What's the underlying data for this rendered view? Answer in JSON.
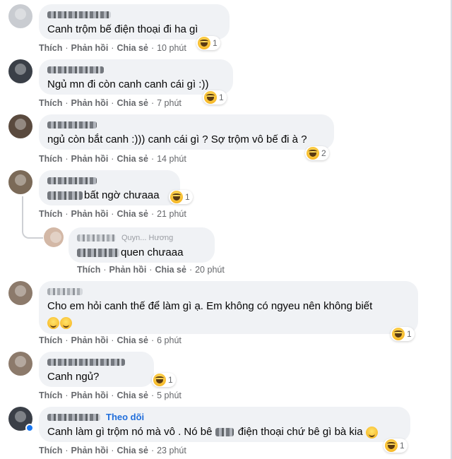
{
  "labels": {
    "like": "Thích",
    "reply": "Phản hồi",
    "share": "Chia sẻ",
    "dot": "·",
    "follow": "Theo dõi"
  },
  "comments": [
    {
      "text": "Canh trộm bế điện thoại đi ha gì",
      "time": "10 phút",
      "reaction_icon": "haha-icon",
      "reaction_count": "1"
    },
    {
      "text": "Ngủ mn đi còn canh canh cái gì :))",
      "time": "7 phút",
      "reaction_icon": "haha-icon",
      "reaction_count": "1"
    },
    {
      "text": "ngủ còn bắt canh :))) canh cái gì ? Sợ trộm vô bế đi à ?",
      "time": "14 phút",
      "reaction_icon": "haha-icon",
      "reaction_count": "2"
    },
    {
      "text": "bất ngờ chưaaa",
      "time": "21 phút",
      "reaction_icon": "haha-icon",
      "reaction_count": "1"
    },
    {
      "author_fragment": "Quyn... Hương",
      "text": "quen chưaaa",
      "time": "20 phút"
    },
    {
      "text": "Cho em hỏi canh thế để làm gì ạ. Em không có ngyeu nên không biết",
      "time": "6 phút",
      "reaction_icon": "haha-icon",
      "reaction_count": "1"
    },
    {
      "text": "Canh ngủ?",
      "time": "5 phút",
      "reaction_icon": "haha-icon",
      "reaction_count": "1"
    },
    {
      "text_before": "Canh làm gì trộm nó mà vô . Nó bê",
      "text_after": "điện thoại chứ bê gì bà kia",
      "time": "23 phút",
      "reaction_icon": "haha-icon",
      "reaction_count": "1"
    }
  ]
}
